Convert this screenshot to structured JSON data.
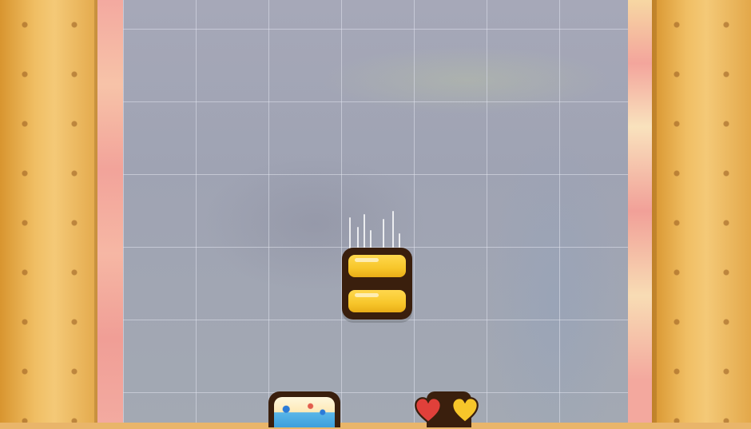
{
  "scene": {
    "walls": "biscuit",
    "board": "grid"
  },
  "falling_piece": {
    "type": "caramel-sandwich",
    "colors": {
      "fill": "#f7c62a",
      "outline": "#3a1f0d"
    }
  },
  "tray": [
    {
      "type": "frosted-cake",
      "colors": {
        "top": "#fff7dd",
        "icing": "#3d9fdc"
      }
    },
    {
      "type": "hearts",
      "colors": {
        "left": "#e0403a",
        "right": "#f7c62a"
      }
    }
  ],
  "colors": {
    "wall": "#f0be63",
    "strip": "#f3a9a0",
    "board": "#a6a8b8",
    "grid_line": "#e1e4ee"
  }
}
